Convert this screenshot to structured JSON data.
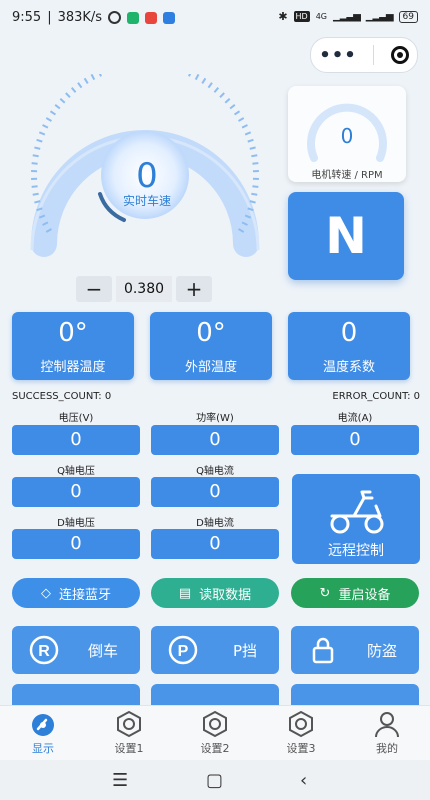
{
  "status_bar": {
    "time": "9:55",
    "speed": "383K/s",
    "right_badges": "HD",
    "net": "4G",
    "battery": "69"
  },
  "gauge": {
    "value": "0",
    "label": "实时车速"
  },
  "rpm": {
    "value": "0",
    "label": "电机转速 / RPM"
  },
  "gear": {
    "value": "N"
  },
  "stepper": {
    "minus": "−",
    "value": "0.380",
    "plus": "+"
  },
  "temps": [
    {
      "value": "0°",
      "label": "控制器温度"
    },
    {
      "value": "0°",
      "label": "外部温度"
    },
    {
      "value": "0",
      "label": "温度系数"
    }
  ],
  "counts": {
    "success": "SUCCESS_COUNT: 0",
    "error": "ERROR_COUNT: 0"
  },
  "fields": {
    "voltage": {
      "label": "电压(V)",
      "value": "0"
    },
    "power": {
      "label": "功率(W)",
      "value": "0"
    },
    "current": {
      "label": "电流(A)",
      "value": "0"
    },
    "q_voltage": {
      "label": "Q轴电压",
      "value": "0"
    },
    "q_current": {
      "label": "Q轴电流",
      "value": "0"
    },
    "d_voltage": {
      "label": "D轴电压",
      "value": "0"
    },
    "d_current": {
      "label": "D轴电流",
      "value": "0"
    }
  },
  "remote": {
    "label": "远程控制"
  },
  "actions": {
    "connect": "连接蓝牙",
    "read": "读取数据",
    "restart": "重启设备"
  },
  "functions": {
    "reverse": "倒车",
    "park": "P挡",
    "antitheft": "防盗"
  },
  "tabs": [
    {
      "label": "显示"
    },
    {
      "label": "设置1"
    },
    {
      "label": "设置2"
    },
    {
      "label": "设置3"
    },
    {
      "label": "我的"
    }
  ],
  "colors": {
    "primary": "#3f8ce6",
    "connect": "#3d8fe8",
    "read": "#2eaf92",
    "restart": "#27a25b",
    "background": "#eef3f8"
  }
}
